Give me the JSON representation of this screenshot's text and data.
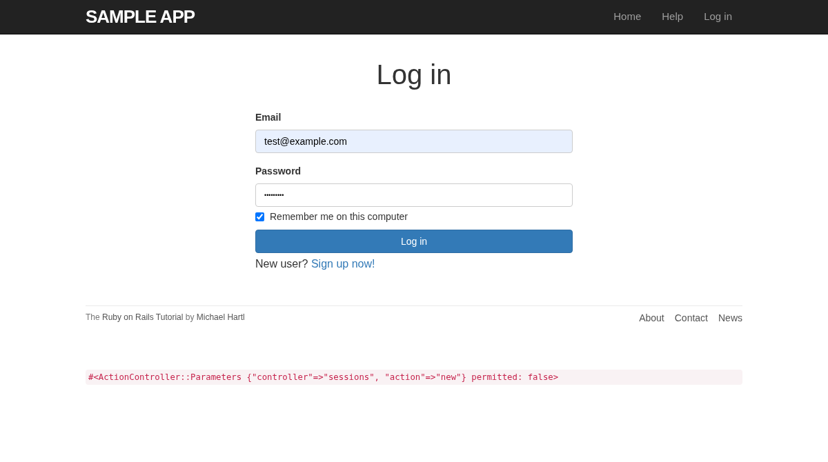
{
  "navbar": {
    "logo": "SAMPLE APP",
    "links": [
      "Home",
      "Help",
      "Log in"
    ]
  },
  "heading": "Log in",
  "form": {
    "email_label": "Email",
    "email_value": "test@example.com",
    "password_label": "Password",
    "password_value": "•••••••••",
    "remember_label": "Remember me on this computer",
    "remember_checked": true,
    "submit": "Log in",
    "signup_prompt": "New user?",
    "signup_link": "Sign up now!"
  },
  "footer": {
    "credit": [
      {
        "text": "The ",
        "link": false
      },
      {
        "text": "Ruby on Rails Tutorial",
        "link": true
      },
      {
        "text": " by ",
        "link": false
      },
      {
        "text": "Michael Hartl",
        "link": true
      }
    ],
    "links": [
      "About",
      "Contact",
      "News"
    ]
  },
  "debug": "#<ActionController::Parameters {\"controller\"=>\"sessions\", \"action\"=>\"new\"} permitted: false>"
}
